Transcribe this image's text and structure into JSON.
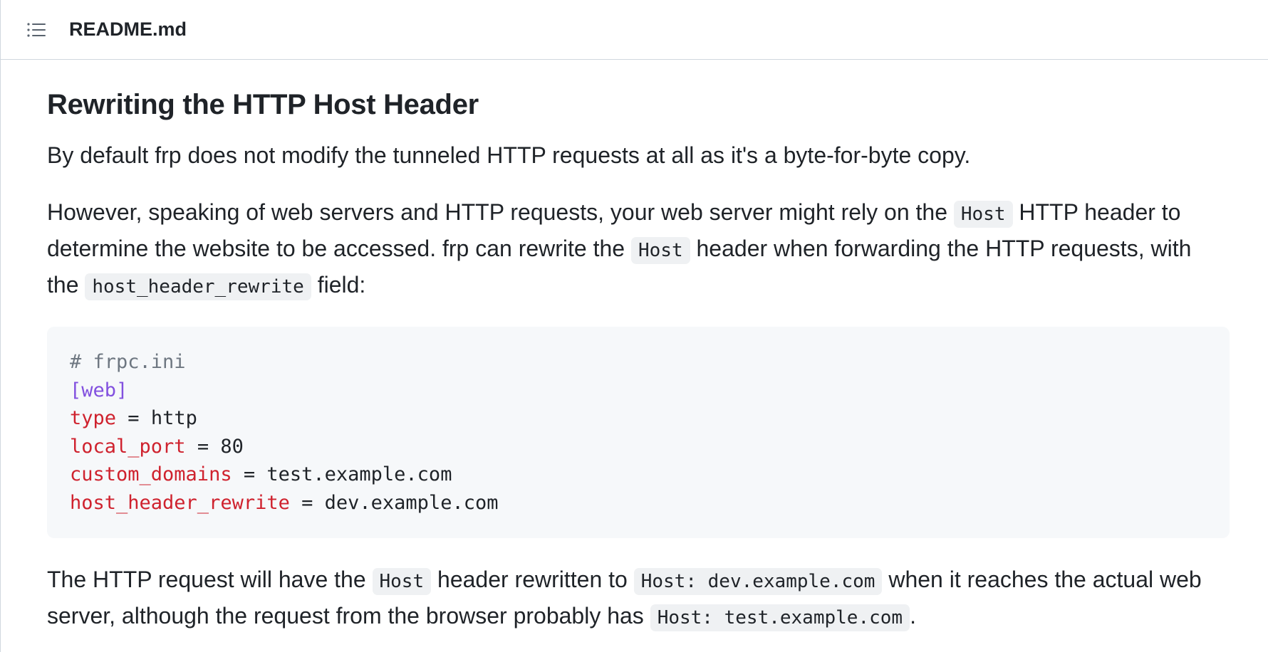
{
  "header": {
    "file_name": "README.md",
    "toc_icon": "list-unordered-icon"
  },
  "article": {
    "heading": "Rewriting the HTTP Host Header",
    "para1": "By default frp does not modify the tunneled HTTP requests at all as it's a byte-for-byte copy.",
    "para2": {
      "t1": "However, speaking of web servers and HTTP requests, your web server might rely on the ",
      "c1": "Host",
      "t2": " HTTP header to determine the website to be accessed. frp can rewrite the ",
      "c2": "Host",
      "t3": " header when forwarding the HTTP requests, with the ",
      "c3": "host_header_rewrite",
      "t4": " field:"
    },
    "code": {
      "comment": "# frpc.ini",
      "section": "[web]",
      "lines": [
        {
          "key": "type",
          "op": " = ",
          "value": "http"
        },
        {
          "key": "local_port",
          "op": " = ",
          "value": "80"
        },
        {
          "key": "custom_domains",
          "op": " = ",
          "value": "test.example.com"
        },
        {
          "key": "host_header_rewrite",
          "op": " = ",
          "value": "dev.example.com"
        }
      ]
    },
    "para3": {
      "t1": "The HTTP request will have the ",
      "c1": "Host",
      "t2": " header rewritten to ",
      "c2": "Host: dev.example.com",
      "t3": " when it reaches the actual web server, although the request from the browser probably has ",
      "c3": "Host: test.example.com",
      "t4": "."
    }
  },
  "colors": {
    "text": "#1f2328",
    "code_bg": "#f6f8fa",
    "inline_code_bg": "#eff1f3",
    "comment": "#6e7781",
    "section": "#8250df",
    "key": "#cf222e",
    "border": "#d0d7de"
  }
}
